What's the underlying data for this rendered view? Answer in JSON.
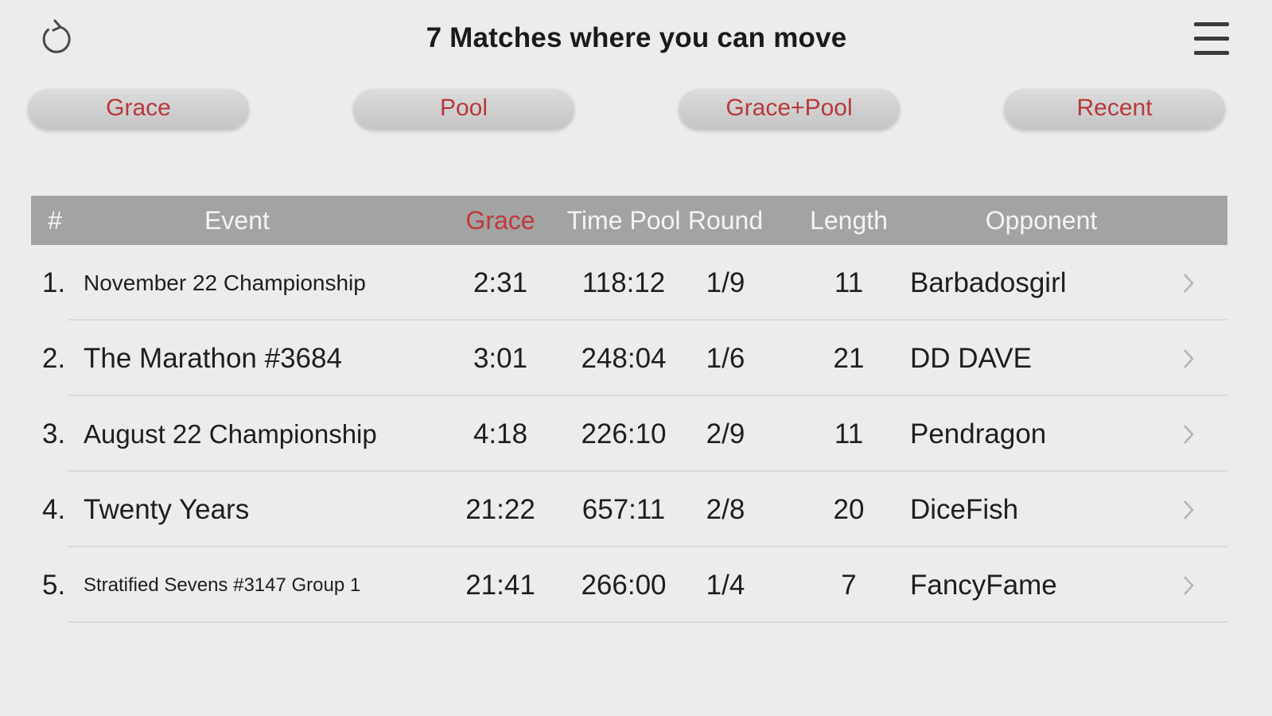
{
  "header": {
    "title": "7 Matches where you can move"
  },
  "filters": [
    {
      "label": "Grace"
    },
    {
      "label": "Pool"
    },
    {
      "label": "Grace+Pool"
    },
    {
      "label": "Recent"
    }
  ],
  "table": {
    "columns": [
      "#",
      "Event",
      "Grace",
      "Time Pool",
      "Round",
      "Length",
      "Opponent"
    ],
    "rows": [
      {
        "num": "1.",
        "event": "November 22 Championship",
        "grace": "2:31",
        "pool": "118:12",
        "round": "1/9",
        "length": "11",
        "opponent": "Barbadosgirl"
      },
      {
        "num": "2.",
        "event": "The Marathon #3684",
        "grace": "3:01",
        "pool": "248:04",
        "round": "1/6",
        "length": "21",
        "opponent": "DD DAVE"
      },
      {
        "num": "3.",
        "event": "August 22 Championship",
        "grace": "4:18",
        "pool": "226:10",
        "round": "2/9",
        "length": "11",
        "opponent": "Pendragon"
      },
      {
        "num": "4.",
        "event": "Twenty Years",
        "grace": "21:22",
        "pool": "657:11",
        "round": "2/8",
        "length": "20",
        "opponent": "DiceFish"
      },
      {
        "num": "5.",
        "event": "Stratified Sevens #3147 Group 1",
        "grace": "21:41",
        "pool": "266:00",
        "round": "1/4",
        "length": "7",
        "opponent": "FancyFame"
      }
    ]
  },
  "colors": {
    "accent": "#c0393b",
    "header_bg": "#a3a3a3",
    "page_bg": "#ececec"
  },
  "icons": {
    "refresh": "refresh-icon",
    "menu": "hamburger-menu-icon",
    "row_chevron": "chevron-right-icon"
  }
}
